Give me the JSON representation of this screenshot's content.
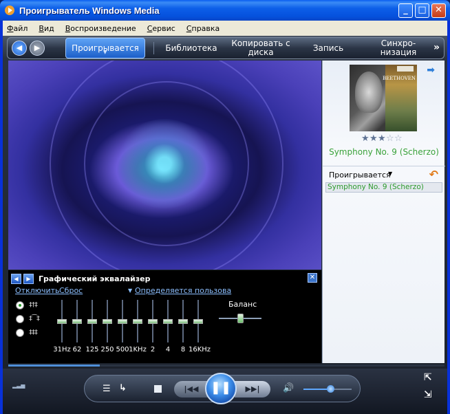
{
  "window": {
    "title": "Проигрыватель Windows Media"
  },
  "titlebar_buttons": {
    "minimize": "_",
    "maximize": "□",
    "close": "✕"
  },
  "menu": [
    "Файл",
    "Вид",
    "Воспроизведение",
    "Сервис",
    "Справка"
  ],
  "taskbar": {
    "now_playing": "Проигрывается",
    "library": "Библиотека",
    "rip": "Копировать с диска",
    "burn": "Запись",
    "sync": "Синхро- низация",
    "more": "»"
  },
  "now_playing_pane": {
    "album_art_composer": "BEETHOVEN",
    "rating": 3,
    "rating_max": 5,
    "track_title": "Symphony No. 9 (Scherzo)",
    "playlist_label": "Проигрывается",
    "playlist_items": [
      "Symphony No. 9 (Scherzo)"
    ]
  },
  "equalizer": {
    "title": "Графический эквалайзер",
    "disable": "Отключить",
    "reset": "Сброс",
    "preset": "Определяется пользова",
    "bands": [
      {
        "label": "31Hz",
        "level": 0
      },
      {
        "label": "62",
        "level": 0
      },
      {
        "label": "125",
        "level": 0
      },
      {
        "label": "250",
        "level": 0
      },
      {
        "label": "500",
        "level": 0
      },
      {
        "label": "1KHz",
        "level": 0
      },
      {
        "label": "2",
        "level": 0
      },
      {
        "label": "4",
        "level": 0
      },
      {
        "label": "8",
        "level": 0
      },
      {
        "label": "16KHz",
        "level": 0
      }
    ],
    "balance_label": "Баланс",
    "balance": 0.5
  },
  "seek_progress": 0.21,
  "volume": 0.55,
  "colors": {
    "title_bar": "#0d5fe8",
    "track_green": "#3aa23a",
    "eq_link": "#8cbfff"
  },
  "icons": {
    "back": "◀",
    "forward": "▶",
    "shuffle": "☰",
    "repeat": "↳",
    "prev": "|◀◀",
    "pause": "❚❚",
    "next": "▶▶|",
    "mute": "🔊",
    "compact": "⇱",
    "fullscreen": "⇲"
  }
}
